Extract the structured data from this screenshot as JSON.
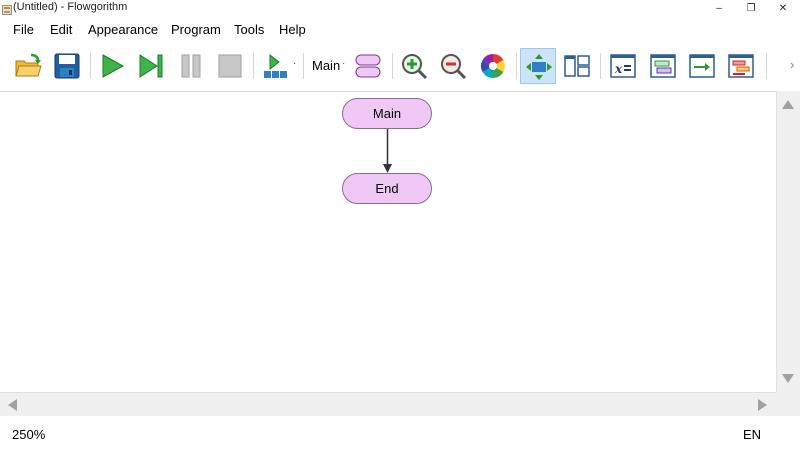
{
  "window": {
    "title": "(Untitled) - Flowgorithm",
    "minimize_glyph": "–",
    "maximize_glyph": "❐",
    "close_glyph": "✕"
  },
  "menu": {
    "items": [
      "File",
      "Edit",
      "Appearance",
      "Program",
      "Tools",
      "Help"
    ]
  },
  "toolbar": {
    "function_selector": "Main",
    "buttons": [
      {
        "name": "open-icon"
      },
      {
        "name": "save-icon"
      },
      {
        "name": "run-icon"
      },
      {
        "name": "step-icon"
      },
      {
        "name": "pause-icon"
      },
      {
        "name": "stop-icon"
      },
      {
        "name": "layout-icon"
      },
      {
        "name": "function-manager-icon"
      },
      {
        "name": "zoom-in-icon"
      },
      {
        "name": "zoom-out-icon"
      },
      {
        "name": "color-wheel-icon"
      },
      {
        "name": "flowchart-view-icon"
      },
      {
        "name": "split-view-icon"
      },
      {
        "name": "variable-watch-icon"
      },
      {
        "name": "console-icon"
      },
      {
        "name": "output-icon"
      },
      {
        "name": "source-code-icon"
      }
    ]
  },
  "flowchart": {
    "start_label": "Main",
    "end_label": "End"
  },
  "status": {
    "zoom": "250%",
    "language": "EN"
  },
  "colors": {
    "terminal_fill": "#f0c8f5",
    "terminal_border": "#8a6a9a",
    "active_button": "#cce4f7"
  }
}
